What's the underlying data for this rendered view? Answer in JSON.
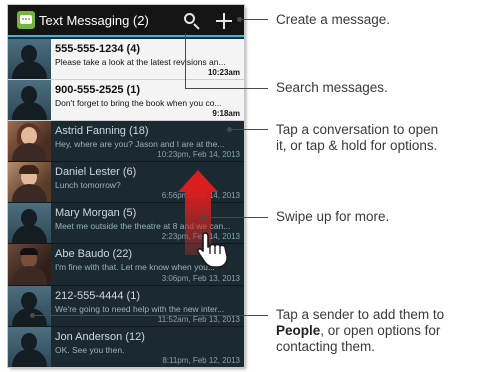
{
  "app": {
    "title": "Text Messaging (2)",
    "icon": "messaging-app-icon",
    "accent": "#33b5e5"
  },
  "actions": {
    "search_icon": "search-icon",
    "add_icon": "plus-icon"
  },
  "conversations": [
    {
      "name": "555-555-1234 (4)",
      "preview": "Please take a look at the latest revisions an...",
      "time": "10:23am",
      "unread": true
    },
    {
      "name": "900-555-2525 (1)",
      "preview": "Don't forget to bring the book when you co...",
      "time": "9:18am",
      "unread": true
    },
    {
      "name": "Astrid Fanning (18)",
      "preview": "Hey, where are you? Jason and I are at the...",
      "time": "10:23pm, Feb 14, 2013",
      "unread": false
    },
    {
      "name": "Daniel Lester (6)",
      "preview": "Lunch tomorrow?",
      "time": "6:56pm, Feb 14, 2013",
      "unread": false
    },
    {
      "name": "Mary Morgan (5)",
      "preview": "Meet me outside the theatre at 8 and we can...",
      "time": "2:23pm, Feb 14, 2013",
      "unread": false
    },
    {
      "name": "Abe Baudo (22)",
      "preview": "I'm fine with that. Let me know when you...",
      "time": "3:06pm, Feb 13, 2013",
      "unread": false
    },
    {
      "name": "212-555-4444 (1)",
      "preview": "We're going to need help with the new inter...",
      "time": "11:52am, Feb 13, 2013",
      "unread": false
    },
    {
      "name": "Jon Anderson (12)",
      "preview": "OK. See you then.",
      "time": "8:11pm, Feb 12, 2013",
      "unread": false
    }
  ],
  "callouts": {
    "create": "Create a message.",
    "search": "Search messages.",
    "tap_line1": "Tap a conversation to open",
    "tap_line2": "it, or tap & hold for options.",
    "swipe": "Swipe up for more.",
    "sender_line1": "Tap a sender to add them to",
    "sender_bold": "People",
    "sender_line2_rest": ", or open options for",
    "sender_line3": "contacting them."
  },
  "colors": {
    "list_bg": "#1b2a31",
    "unread_bg": "#f4f4f4",
    "swipe_arrow": "#d81e1e"
  }
}
